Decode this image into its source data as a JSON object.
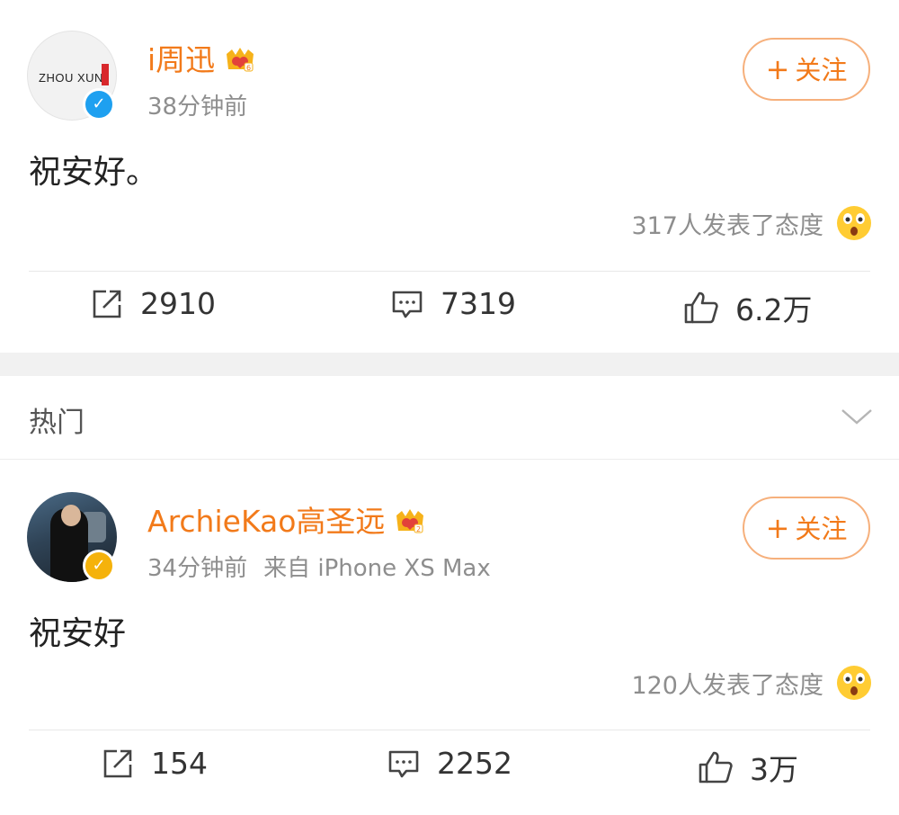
{
  "posts": [
    {
      "author": "i周迅",
      "avatar_text": "ZHOU XUN",
      "time": "38分钟前",
      "source": "",
      "follow_label": "关注",
      "content": "祝安好。",
      "reactions_text": "317人发表了态度",
      "reposts": "2910",
      "comments": "7319",
      "likes": "6.2万",
      "badge": "verified-blue"
    },
    {
      "author": "ArchieKao高圣远",
      "time": "34分钟前",
      "source": "来自 iPhone XS Max",
      "follow_label": "关注",
      "content": "祝安好",
      "reactions_text": "120人发表了态度",
      "reposts": "154",
      "comments": "2252",
      "likes": "3万",
      "badge": "verified-gold"
    }
  ],
  "section": {
    "title": "热门"
  },
  "colors": {
    "accent": "#f27a1a",
    "verified_blue": "#1ea0f0",
    "verified_gold": "#f5b20b",
    "muted": "#8e8e8e"
  },
  "icons": [
    "crown-icon",
    "repost-icon",
    "comment-icon",
    "like-icon",
    "surprised-emoji-icon",
    "chevron-down-icon",
    "verified-icon"
  ]
}
